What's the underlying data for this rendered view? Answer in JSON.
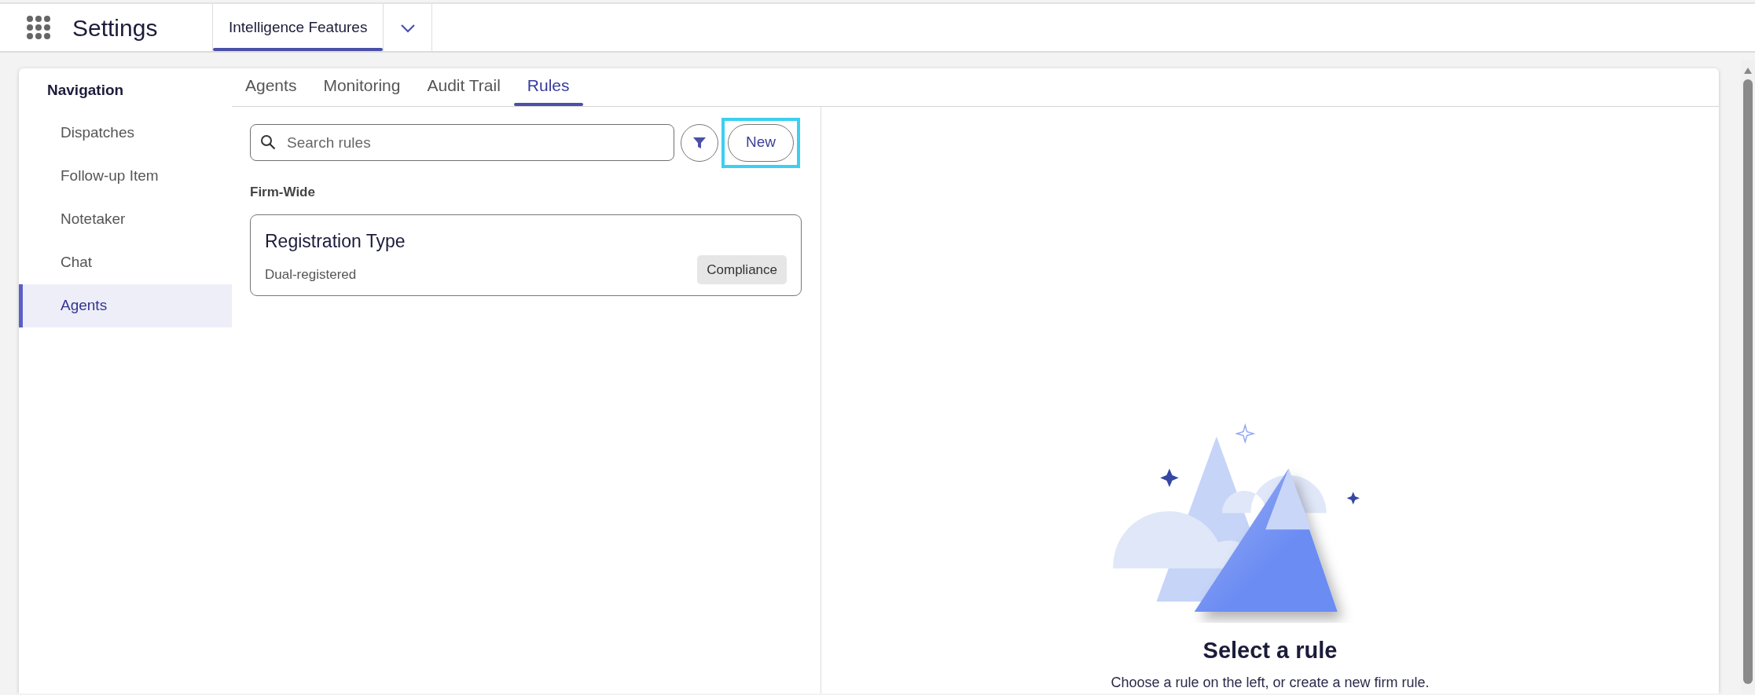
{
  "app_bar": {
    "title": "Settings",
    "tabs": [
      {
        "label": "Intelligence Features",
        "selected": true
      }
    ]
  },
  "navigation": {
    "heading": "Navigation",
    "items": [
      {
        "label": "Dispatches",
        "selected": false
      },
      {
        "label": "Follow-up Item",
        "selected": false
      },
      {
        "label": "Notetaker",
        "selected": false
      },
      {
        "label": "Chat",
        "selected": false
      },
      {
        "label": "Agents",
        "selected": true
      }
    ]
  },
  "tabs": [
    {
      "label": "Agents",
      "selected": false
    },
    {
      "label": "Monitoring",
      "selected": false
    },
    {
      "label": "Audit Trail",
      "selected": false
    },
    {
      "label": "Rules",
      "selected": true
    }
  ],
  "rules_panel": {
    "search": {
      "placeholder": "Search rules"
    },
    "new_button": {
      "label": "New",
      "focused": true
    },
    "sections": [
      {
        "heading": "Firm-Wide",
        "rules": [
          {
            "title": "Registration Type",
            "subtitle": "Dual-registered",
            "tag": "Compliance"
          }
        ]
      }
    ]
  },
  "detail": {
    "title": "Select a rule",
    "message": "Choose a rule on the left, or create a new firm rule."
  }
}
